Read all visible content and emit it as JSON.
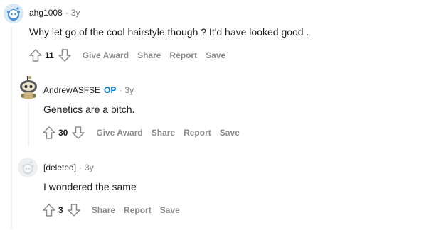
{
  "comments": [
    {
      "author": "ahg1008",
      "separator": "·",
      "time": "3y",
      "body": "Why let go of the cool hairstyle though ? It'd have looked good .",
      "score": "11",
      "actions": {
        "give_award": "Give Award",
        "share": "Share",
        "report": "Report",
        "save": "Save"
      },
      "avatar_icon": "snoo-avatar-icon"
    },
    {
      "author": "AndrewASFSE",
      "op_badge": "OP",
      "separator": "·",
      "time": "3y",
      "body": "Genetics are a bitch.",
      "score": "30",
      "actions": {
        "give_award": "Give Award",
        "share": "Share",
        "report": "Report",
        "save": "Save"
      },
      "avatar_icon": "snoo-helmet-avatar-icon"
    },
    {
      "author": "[deleted]",
      "separator": "·",
      "time": "3y",
      "body": "I wondered the same",
      "score": "3",
      "actions": {
        "share": "Share",
        "report": "Report",
        "save": "Save"
      },
      "avatar_icon": "deleted-user-avatar-icon"
    }
  ],
  "colors": {
    "accent": "#0079d3",
    "meta": "#7c7c7c",
    "action": "#878a8c",
    "thread_line": "#edeff1",
    "text": "#1c1c1c"
  }
}
